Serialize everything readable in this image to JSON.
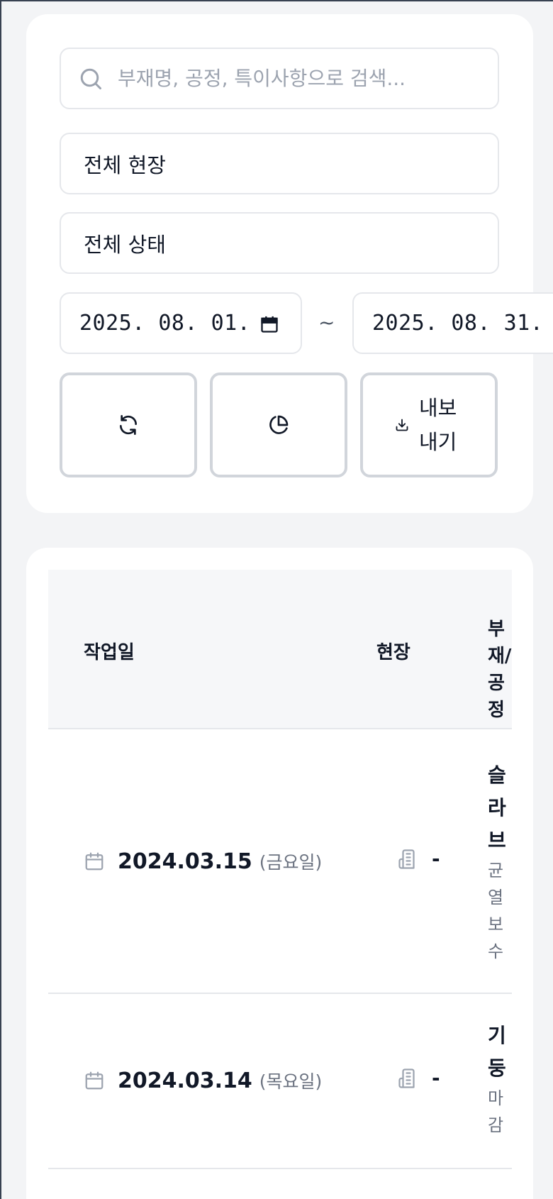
{
  "filters": {
    "search_placeholder": "부재명, 공정, 특이사항으로 검색...",
    "site_select": "전체 현장",
    "status_select": "전체 상태",
    "date_from": "2025. 08. 01.",
    "date_separator": "~",
    "date_to": "2025. 08. 31.",
    "export_label": "내보내기"
  },
  "table": {
    "headers": {
      "date": "작업일",
      "site": "현장",
      "part": "부재/공정"
    },
    "rows": [
      {
        "date": "2024.03.15",
        "day": "(금요일)",
        "site": "-",
        "part": "슬라브",
        "process": "균열보수"
      },
      {
        "date": "2024.03.14",
        "day": "(목요일)",
        "site": "-",
        "part": "기둥",
        "process": "마감"
      }
    ]
  },
  "icons": {
    "search": "search-icon",
    "calendar": "calendar-icon",
    "refresh": "refresh-icon",
    "pie_chart": "pie-chart-icon",
    "download": "download-icon",
    "building": "building-icon"
  },
  "colors": {
    "border": "#e5e7eb",
    "muted_text": "#6b7280",
    "header_bg": "#f6f7f9"
  }
}
